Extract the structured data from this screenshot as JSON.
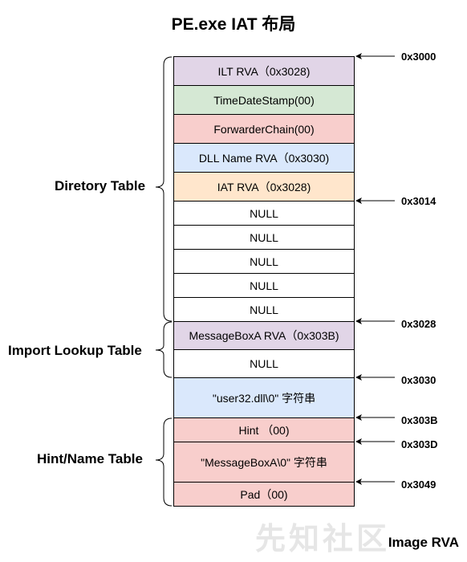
{
  "title": "PE.exe IAT 布局",
  "footer": "Image RVA",
  "watermark": "先知社区",
  "colors": {
    "purple": "#e1d5e7",
    "green": "#d5e8d4",
    "red": "#f8cecc",
    "blue": "#dae8fc",
    "orange": "#ffe6cc",
    "white": "#ffffff"
  },
  "cells": [
    {
      "label": "ILT RVA（0x3028)",
      "color": "purple"
    },
    {
      "label": "TimeDateStamp(00)",
      "color": "green"
    },
    {
      "label": "ForwarderChain(00)",
      "color": "red"
    },
    {
      "label": "DLL Name RVA（0x3030)",
      "color": "blue"
    },
    {
      "label": "IAT RVA（0x3028)",
      "color": "orange"
    },
    {
      "label": "NULL",
      "color": "white"
    },
    {
      "label": "NULL",
      "color": "white"
    },
    {
      "label": "NULL",
      "color": "white"
    },
    {
      "label": "NULL",
      "color": "white"
    },
    {
      "label": "NULL",
      "color": "white"
    },
    {
      "label": "MessageBoxA RVA（0x303B)",
      "color": "purple"
    },
    {
      "label": "NULL",
      "color": "white"
    },
    {
      "label": "\"user32.dll\\0\" 字符串",
      "color": "blue"
    },
    {
      "label": "Hint （00)",
      "color": "red"
    },
    {
      "label": "\"MessageBoxA\\0\" 字符串",
      "color": "red"
    },
    {
      "label": "Pad（00)",
      "color": "red"
    }
  ],
  "addresses": [
    "0x3000",
    "0x3014",
    "0x3028",
    "0x3030",
    "0x303B",
    "0x303D",
    "0x3049"
  ],
  "groups": [
    {
      "label": "Diretory Table"
    },
    {
      "label": "Import Lookup Table"
    },
    {
      "label": "Hint/Name Table"
    }
  ]
}
